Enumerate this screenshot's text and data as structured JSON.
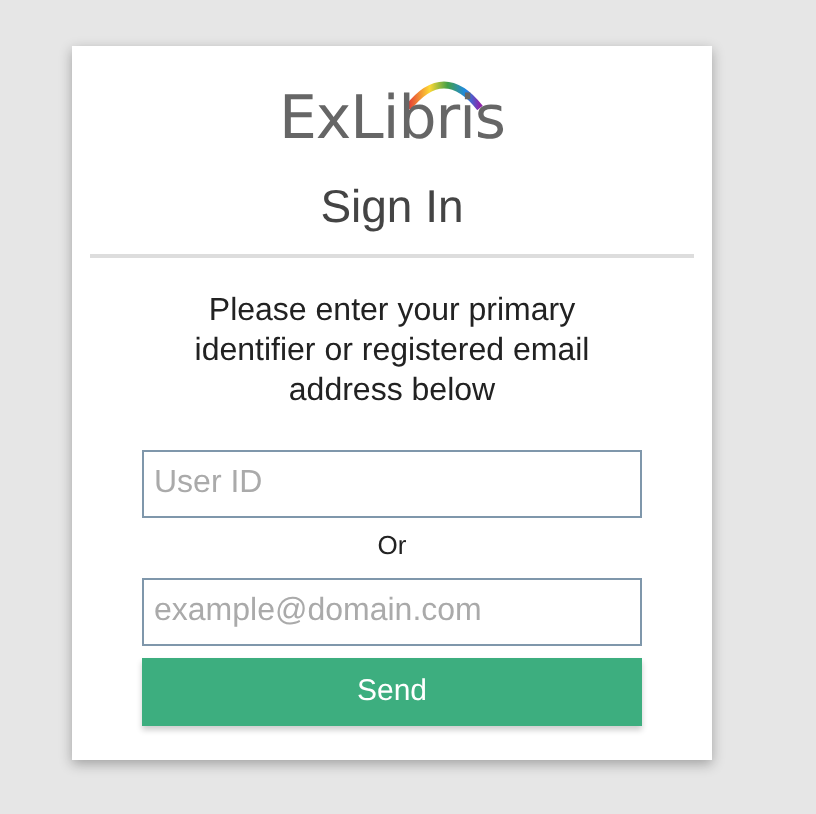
{
  "logo": {
    "text": "ExLibris"
  },
  "title": "Sign In",
  "instructions": "Please enter your primary identifier or registered email address below",
  "user_id_field": {
    "placeholder": "User ID"
  },
  "separator": "Or",
  "email_field": {
    "placeholder": "example@domain.com"
  },
  "send_button": {
    "label": "Send"
  }
}
